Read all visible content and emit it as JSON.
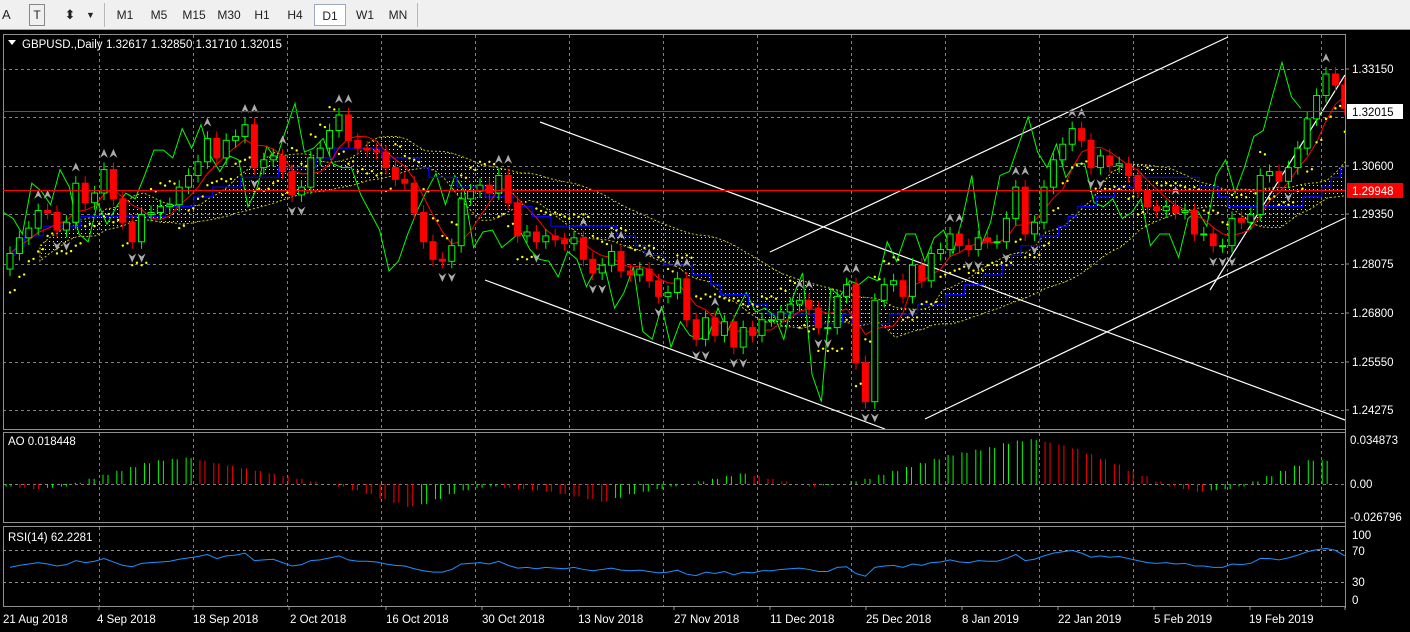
{
  "toolbar": {
    "tools": [
      {
        "name": "text-tool-icon",
        "glyph": "A"
      },
      {
        "name": "text-label-tool-icon",
        "glyph": "T"
      },
      {
        "name": "arrows-tool-icon",
        "glyph": "⬍"
      }
    ],
    "timeframes": [
      "M1",
      "M5",
      "M15",
      "M30",
      "H1",
      "H4",
      "D1",
      "W1",
      "MN"
    ],
    "active_timeframe": "D1"
  },
  "main_chart": {
    "symbol_label": "GBPUSD.,Daily",
    "ohlc_label": "1.32617 1.32850 1.31710 1.32015",
    "price_labels": [
      "1.33150",
      "1.30600",
      "1.29350",
      "1.28075",
      "1.26800",
      "1.25550",
      "1.24275"
    ],
    "current_price": "1.32015",
    "marker_price": "1.29948"
  },
  "ao_panel": {
    "label": "AO 0.018448",
    "scale": [
      "0.034873",
      "0.00",
      "-0.026796"
    ]
  },
  "rsi_panel": {
    "label": "RSI(14) 62.2281",
    "scale": [
      "100",
      "70",
      "30",
      "0"
    ]
  },
  "date_labels": [
    "21 Aug 2018",
    "4 Sep 2018",
    "18 Sep 2018",
    "2 Oct 2018",
    "16 Oct 2018",
    "30 Oct 2018",
    "13 Nov 2018",
    "27 Nov 2018",
    "11 Dec 2018",
    "25 Dec 2018",
    "8 Jan 2019",
    "22 Jan 2019",
    "5 Feb 2019",
    "19 Feb 2019"
  ],
  "colors": {
    "background": "#000000",
    "grid": "#7f7f7f",
    "bull": "#00ff00",
    "bear": "#ff0000",
    "ask_line": "#4040ff",
    "marker_line": "#ff0000",
    "tenkan": "#ff0000",
    "kijun": "#0000ff",
    "chikou": "#00ff00",
    "psar": "#ffff00",
    "cloud": "#ffff00",
    "trendline": "#ffffff",
    "rsi": "#1e90ff"
  },
  "chart_data": {
    "type": "candlestick",
    "symbol": "GBPUSD.",
    "timeframe": "Daily",
    "ylim": [
      1.238,
      1.339
    ],
    "open": [
      1.279,
      1.283,
      1.287,
      1.2895,
      1.294,
      1.2935,
      1.289,
      1.291,
      1.301,
      1.296,
      1.2985,
      1.3045,
      1.297,
      1.291,
      1.286,
      1.293,
      1.2935,
      1.295,
      1.2955,
      1.3,
      1.303,
      1.3065,
      1.3125,
      1.3075,
      1.312,
      1.313,
      1.316,
      1.305,
      1.307,
      1.308,
      1.304,
      1.298,
      1.3,
      1.3075,
      1.31,
      1.3145,
      1.3185,
      1.312,
      1.31,
      1.3095,
      1.309,
      1.305,
      1.302,
      1.301,
      1.2935,
      1.286,
      1.2815,
      1.281,
      1.285,
      1.297,
      1.299,
      1.3005,
      1.2985,
      1.303,
      1.296,
      1.2875,
      1.2885,
      1.286,
      1.2875,
      1.2865,
      1.2855,
      1.287,
      1.2815,
      1.278,
      1.28,
      1.2835,
      1.2785,
      1.2775,
      1.279,
      1.276,
      1.272,
      1.273,
      1.2765,
      1.266,
      1.261,
      1.2665,
      1.262,
      1.2655,
      1.259,
      1.264,
      1.262,
      1.266,
      1.266,
      1.268,
      1.27,
      1.271,
      1.269,
      1.264,
      1.264,
      1.272,
      1.275,
      1.255,
      1.245,
      1.271,
      1.275,
      1.276,
      1.272,
      1.28,
      1.276,
      1.283,
      1.284,
      1.288,
      1.285,
      1.284,
      1.287,
      1.286,
      1.286,
      1.292,
      1.3,
      1.288,
      1.291,
      1.3,
      1.307,
      1.311,
      1.315,
      1.312,
      1.305,
      1.308,
      1.3055,
      1.306,
      1.303,
      1.299,
      1.295,
      1.294,
      1.295,
      1.2935,
      1.294,
      1.288,
      1.288,
      1.285,
      1.285,
      1.292,
      1.291,
      1.293,
      1.303,
      1.304,
      1.3015,
      1.305,
      1.31,
      1.3175,
      1.3235,
      1.329,
      1.3262
    ],
    "close": [
      1.283,
      1.287,
      1.2895,
      1.294,
      1.2935,
      1.289,
      1.291,
      1.301,
      1.296,
      1.2985,
      1.3045,
      1.297,
      1.291,
      1.286,
      1.293,
      1.2935,
      1.295,
      1.2955,
      1.3,
      1.303,
      1.3065,
      1.3125,
      1.3075,
      1.312,
      1.313,
      1.316,
      1.305,
      1.307,
      1.308,
      1.304,
      1.298,
      1.3,
      1.3075,
      1.31,
      1.3145,
      1.3185,
      1.312,
      1.31,
      1.3095,
      1.309,
      1.305,
      1.302,
      1.301,
      1.2935,
      1.286,
      1.2815,
      1.281,
      1.285,
      1.297,
      1.299,
      1.3005,
      1.2985,
      1.303,
      1.296,
      1.2875,
      1.2885,
      1.286,
      1.2875,
      1.2865,
      1.2855,
      1.287,
      1.2815,
      1.278,
      1.28,
      1.2835,
      1.2785,
      1.2775,
      1.279,
      1.276,
      1.272,
      1.273,
      1.2765,
      1.266,
      1.261,
      1.2665,
      1.262,
      1.2655,
      1.259,
      1.264,
      1.262,
      1.266,
      1.266,
      1.268,
      1.27,
      1.271,
      1.269,
      1.264,
      1.264,
      1.272,
      1.275,
      1.255,
      1.245,
      1.271,
      1.275,
      1.276,
      1.272,
      1.28,
      1.276,
      1.283,
      1.284,
      1.288,
      1.285,
      1.284,
      1.287,
      1.286,
      1.286,
      1.292,
      1.3,
      1.288,
      1.291,
      1.3,
      1.307,
      1.311,
      1.315,
      1.312,
      1.305,
      1.308,
      1.3055,
      1.306,
      1.303,
      1.299,
      1.295,
      1.294,
      1.295,
      1.2935,
      1.294,
      1.288,
      1.288,
      1.285,
      1.285,
      1.292,
      1.291,
      1.293,
      1.303,
      1.304,
      1.3015,
      1.305,
      1.31,
      1.3175,
      1.3235,
      1.329,
      1.3262,
      1.3202
    ],
    "ao": {
      "label": "AO",
      "last": 0.018448,
      "ylim": [
        -0.026796,
        0.034873
      ],
      "values": [
        -0.002,
        -0.003,
        -0.004,
        -0.003,
        -0.002,
        0.001,
        0.004,
        0.007,
        0.01,
        0.013,
        0.016,
        0.018,
        0.019,
        0.02,
        0.018,
        0.016,
        0.014,
        0.012,
        0.01,
        0.008,
        0.006,
        0.004,
        0.002,
        0.0,
        -0.002,
        -0.005,
        -0.008,
        -0.012,
        -0.015,
        -0.018,
        -0.016,
        -0.012,
        -0.008,
        -0.005,
        -0.003,
        -0.002,
        -0.003,
        -0.004,
        -0.005,
        -0.006,
        -0.008,
        -0.01,
        -0.012,
        -0.014,
        -0.011,
        -0.008,
        -0.006,
        -0.004,
        -0.002,
        0.0,
        0.002,
        0.004,
        0.006,
        0.008,
        0.006,
        0.004,
        0.002,
        0.0,
        -0.002,
        -0.001,
        0.0,
        0.002,
        0.004,
        0.007,
        0.01,
        0.013,
        0.016,
        0.019,
        0.022,
        0.024,
        0.026,
        0.028,
        0.031,
        0.033,
        0.034,
        0.032,
        0.03,
        0.027,
        0.023,
        0.019,
        0.015,
        0.01,
        0.006,
        0.002,
        -0.002,
        -0.004,
        -0.006,
        -0.005,
        -0.004,
        -0.002,
        0.002,
        0.006,
        0.01,
        0.014,
        0.018,
        0.018
      ]
    },
    "rsi": {
      "label": "RSI(14)",
      "last": 62.2281,
      "levels": [
        70,
        30
      ],
      "values": [
        45,
        48,
        50,
        52,
        50,
        47,
        49,
        55,
        52,
        54,
        58,
        53,
        48,
        46,
        51,
        52,
        53,
        54,
        57,
        59,
        61,
        64,
        58,
        62,
        63,
        66,
        55,
        56,
        57,
        52,
        47,
        49,
        55,
        56,
        59,
        62,
        56,
        54,
        54,
        53,
        50,
        48,
        47,
        43,
        40,
        38,
        38,
        42,
        50,
        51,
        52,
        50,
        54,
        48,
        44,
        45,
        43,
        45,
        44,
        43,
        45,
        42,
        40,
        42,
        44,
        41,
        40,
        41,
        39,
        37,
        38,
        41,
        35,
        33,
        38,
        36,
        39,
        34,
        38,
        37,
        40,
        40,
        42,
        43,
        44,
        42,
        39,
        39,
        45,
        46,
        36,
        32,
        45,
        47,
        48,
        45,
        50,
        48,
        52,
        53,
        56,
        53,
        52,
        55,
        54,
        54,
        58,
        64,
        55,
        57,
        62,
        66,
        68,
        70,
        66,
        60,
        62,
        60,
        61,
        58,
        55,
        52,
        51,
        52,
        50,
        51,
        47,
        47,
        45,
        45,
        50,
        49,
        51,
        58,
        58,
        56,
        59,
        63,
        68,
        71,
        73,
        70,
        62
      ]
    }
  }
}
